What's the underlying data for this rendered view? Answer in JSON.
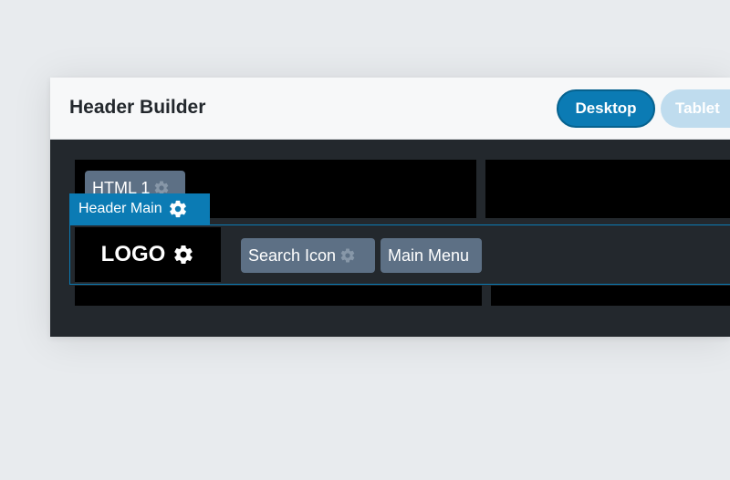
{
  "panel": {
    "title": "Header Builder",
    "devices": [
      {
        "label": "Desktop",
        "active": true
      },
      {
        "label": "Tablet",
        "active": false
      }
    ]
  },
  "builder": {
    "top_row": {
      "element": {
        "label": "HTML 1",
        "icon": "gear-icon"
      }
    },
    "main_row": {
      "tag": {
        "label": "Header Main",
        "icon": "gear-icon"
      },
      "logo": {
        "label": "LOGO",
        "icon": "gear-icon"
      },
      "elements": [
        {
          "label": "Search Icon",
          "icon": "gear-icon"
        },
        {
          "label": "Main Menu"
        }
      ]
    }
  },
  "colors": {
    "accent": "#0b7bb4",
    "tablet_inactive": "#bfdcee",
    "chip": "#5d7085",
    "canvas": "#23282d",
    "cell": "#000000"
  }
}
